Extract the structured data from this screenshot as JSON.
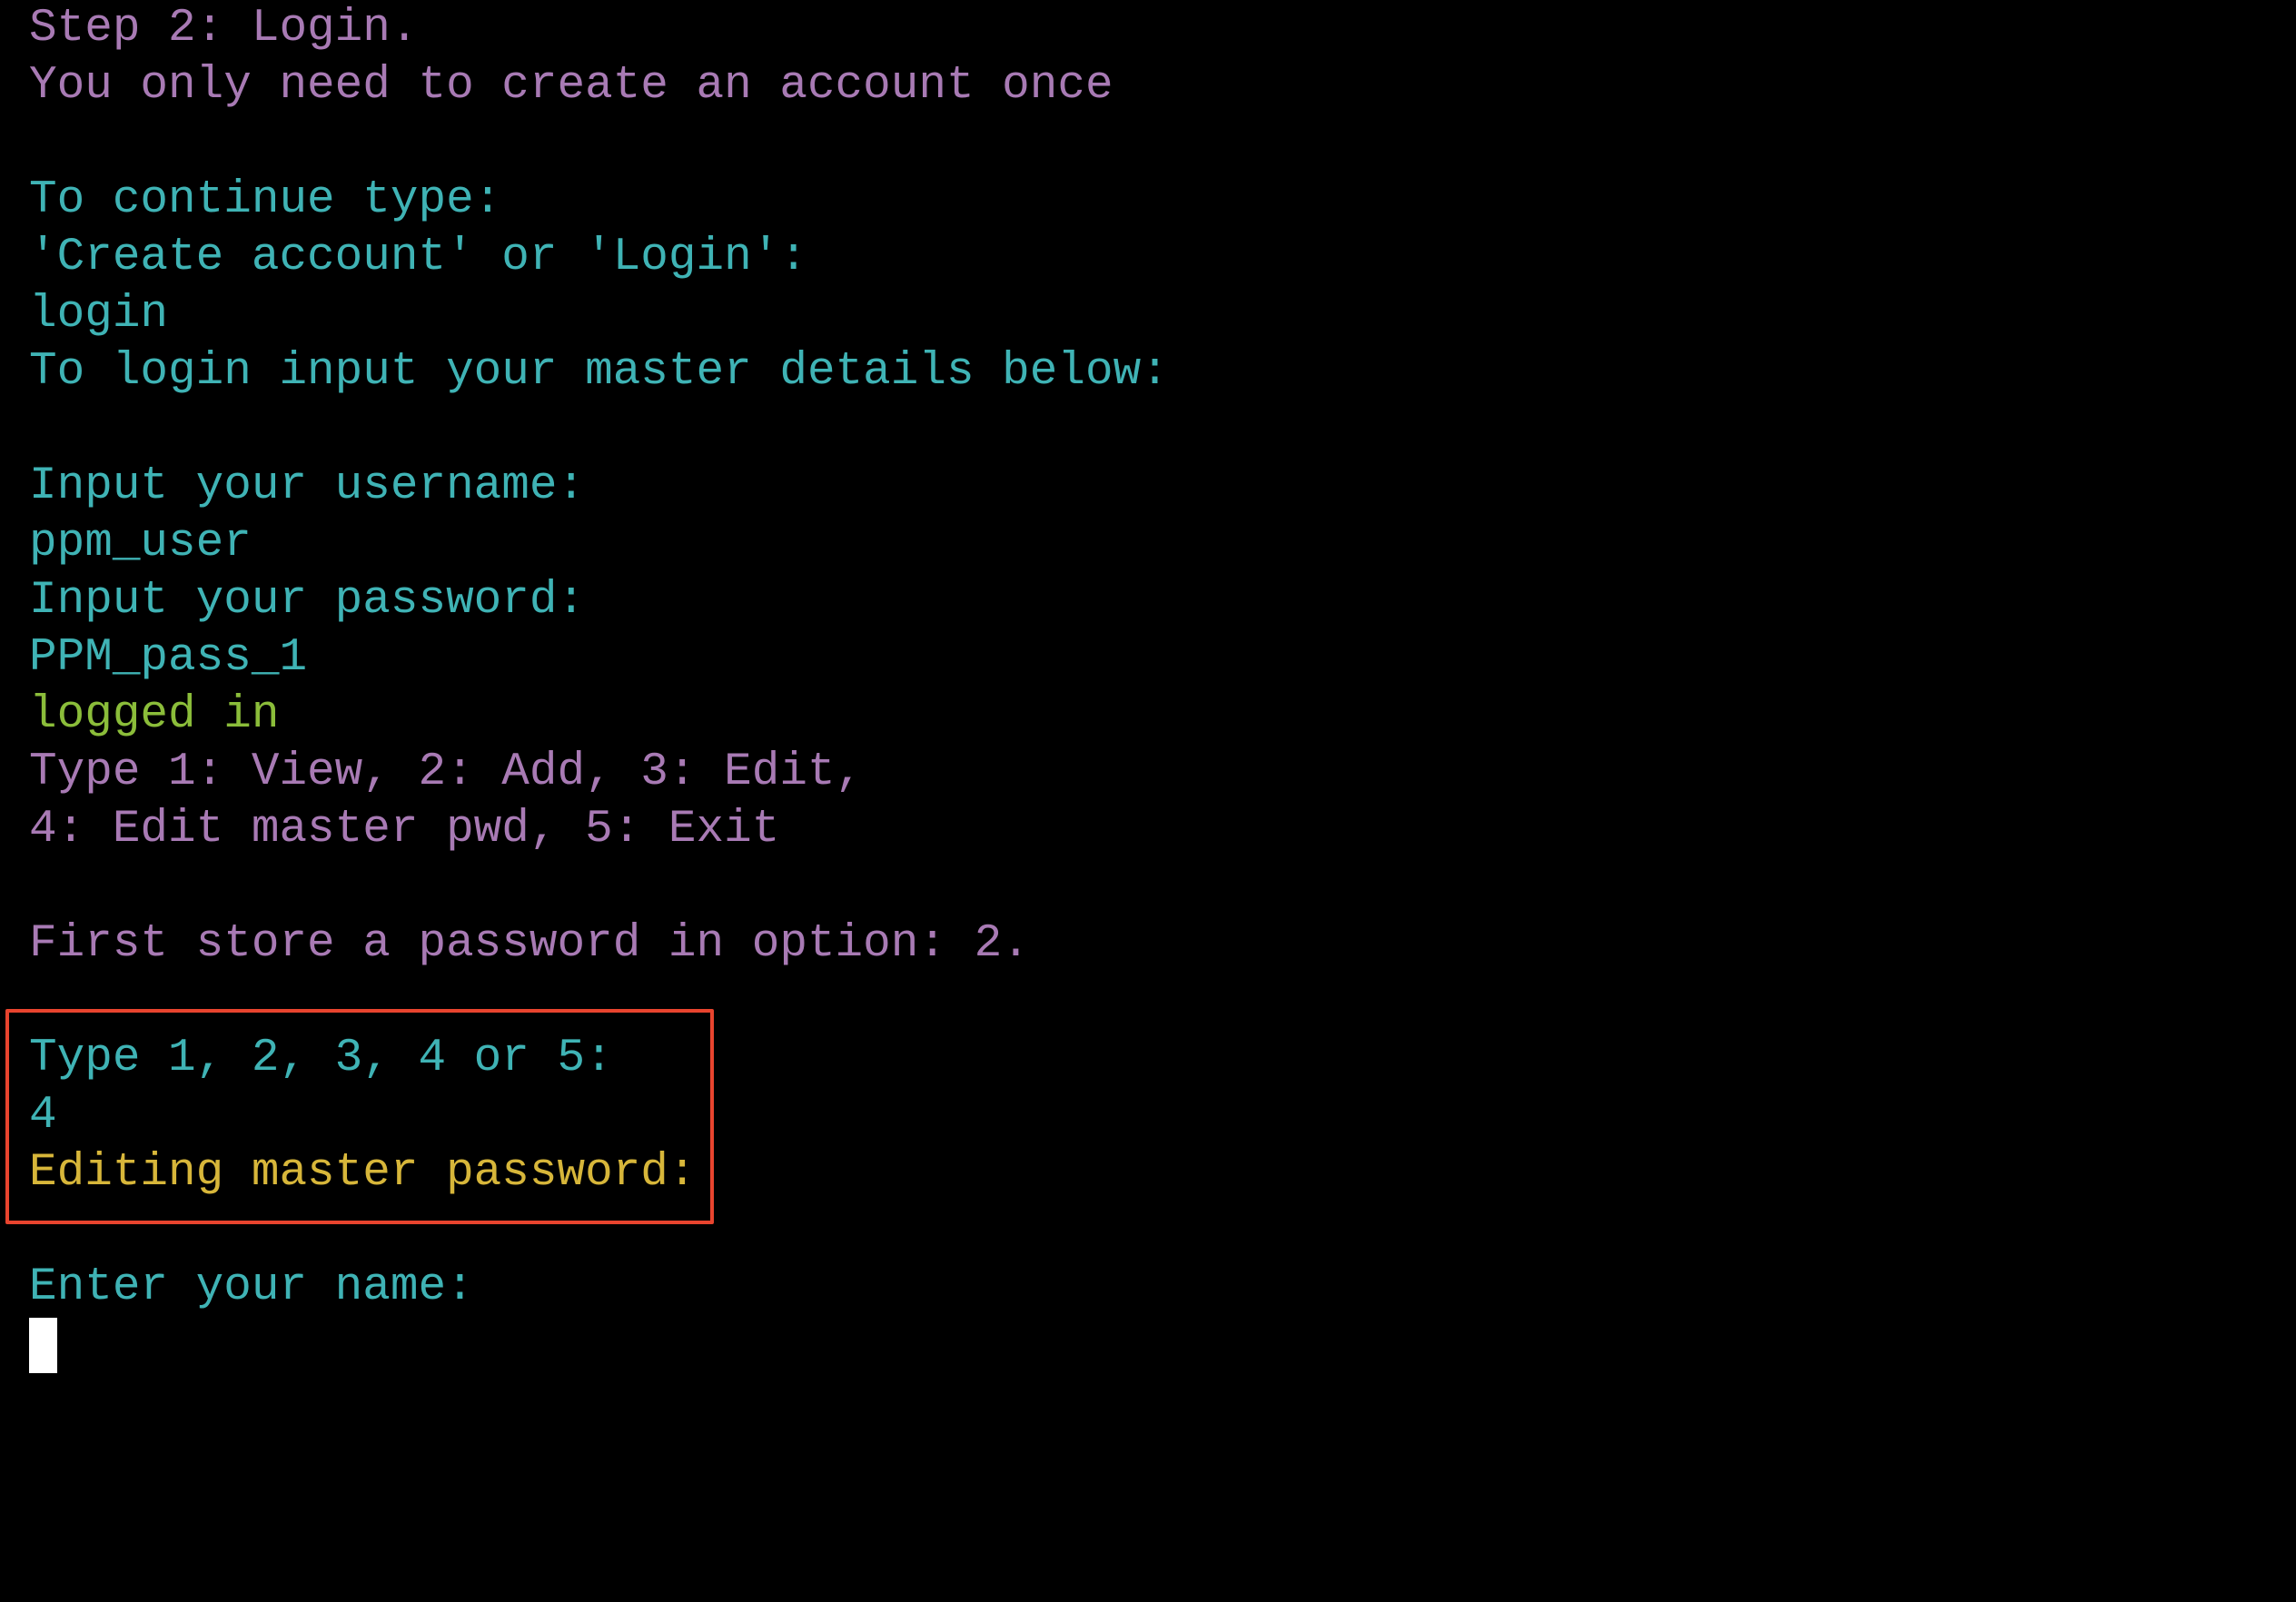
{
  "colors": {
    "background": "#000000",
    "purple_text": "#a87ab4",
    "cyan_text": "#3fb3b5",
    "green_text": "#8bbd3a",
    "yellow_text": "#d7b63a",
    "highlight_border": "#e8442e",
    "cursor": "#ffffff"
  },
  "terminal": {
    "lines": [
      {
        "text": "Step 2: Login."
      },
      {
        "text": "You only need to create an account once"
      },
      {
        "text": "To continue type:"
      },
      {
        "text": "'Create account' or 'Login':"
      },
      {
        "text": "login"
      },
      {
        "text": "To login input your master details below:"
      },
      {
        "text": "Input your username:"
      },
      {
        "text": "ppm_user"
      },
      {
        "text": "Input your password:"
      },
      {
        "text": "PPM_pass_1"
      },
      {
        "text": "logged in"
      },
      {
        "text": "Type 1: View, 2: Add, 3: Edit,"
      },
      {
        "text": "4: Edit master pwd, 5: Exit"
      },
      {
        "text": "First store a password in option: 2."
      },
      {
        "text": "Type 1, 2, 3, 4 or 5:"
      },
      {
        "text": "4"
      },
      {
        "text": "Editing master password:"
      },
      {
        "text": "Enter your name:"
      }
    ]
  }
}
